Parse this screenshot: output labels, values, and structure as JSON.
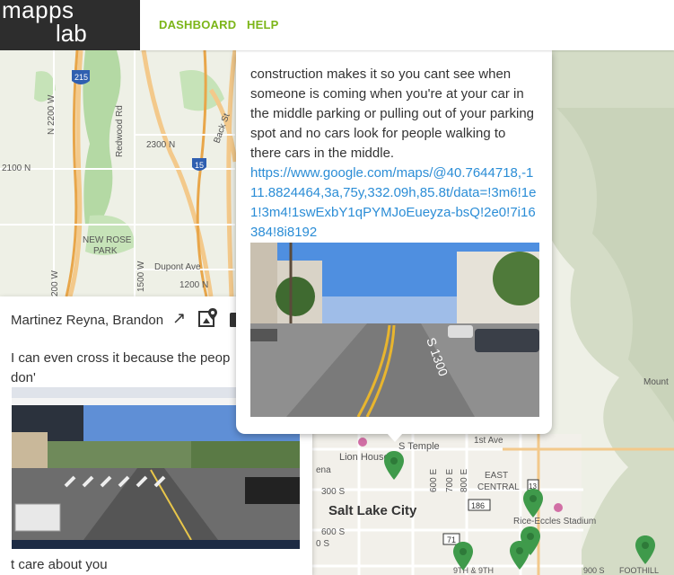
{
  "brand": {
    "line1": "mapps",
    "line2": "lab"
  },
  "nav": {
    "dashboard": "DASHBOARD",
    "help": "HELP"
  },
  "map": {
    "labels": {
      "n2200w": "N 2200 W",
      "redwood": "Redwood Rd",
      "n2300": "2300 N",
      "n2100": "2100 N",
      "backst": "Back St",
      "rosepark": "NEW ROSE",
      "rosepark2": "PARK",
      "dupont": "Dupont Ave",
      "n1200": "1200 N",
      "w1500": "1500 W",
      "w200": "200 W",
      "stemple": "S Temple",
      "lionhouse": "Lion House",
      "ena": "ena",
      "firstave": "1st Ave",
      "s300": "300 S",
      "e600": "600 E",
      "e700": "700 E",
      "e800": "800 E",
      "eastcentral": "EAST",
      "eastcentral2": "CENTRAL",
      "slc": "Salt Lake City",
      "s600": "600 S",
      "s0": "0 S",
      "rice": "Rice-Eccles Stadium",
      "ninth": "9TH & 9TH",
      "s900": "900 S",
      "foothill": "FOOTHILL",
      "mount": "Mount",
      "i215": "215",
      "i15": "15",
      "r186": "186",
      "r71": "71",
      "r13": "13"
    }
  },
  "popup_left": {
    "author": "Martinez Reyna, Brandon",
    "body": "I can even cross it because the peop don'",
    "tail": "t care about you"
  },
  "popup_right": {
    "body": "construction makes it so you cant see when someone is coming when you're at your car in the middle parking or pulling out of your parking spot and no cars look for people walking to there cars in the middle.",
    "link": "https://www.google.com/maps/@40.7644718,-111.8824464,3a,75y,332.09h,85.8t/data=!3m6!1e1!3m4!1swExbY1qPYMJoEueyza-bsQ!2e0!7i16384!8i8192",
    "photo_street": "S 1300"
  },
  "colors": {
    "accent": "#7cb518",
    "link": "#2b8dd6",
    "marker": "#3f9a4b",
    "logo_bg": "#2d2d2d"
  },
  "icons": {
    "expand": "expand-icon",
    "map_pin": "map-pin-icon",
    "trash": "trash-icon",
    "marker": "map-marker-icon"
  }
}
